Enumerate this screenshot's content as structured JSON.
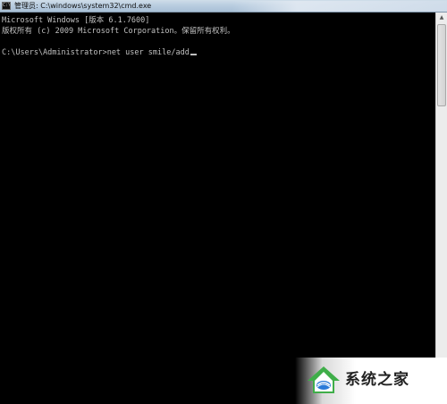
{
  "window": {
    "title": "管理员: C:\\windows\\system32\\cmd.exe",
    "icon": "cmd-icon",
    "icon_glyph": "C:\\"
  },
  "console": {
    "lines": [
      "Microsoft Windows [版本 6.1.7600]",
      "版权所有 (c) 2009 Microsoft Corporation。保留所有权利。",
      "",
      "C:\\Users\\Administrator>net user smile/add"
    ],
    "text_color": "#c0c0c0",
    "background_color": "#000000"
  },
  "watermark": {
    "text": "系统之家",
    "logo_icon": "house-logo-icon"
  },
  "colors": {
    "titlebar": "#b9cde0",
    "logo_green": "#3fae49",
    "logo_blue": "#2a7bd8"
  }
}
